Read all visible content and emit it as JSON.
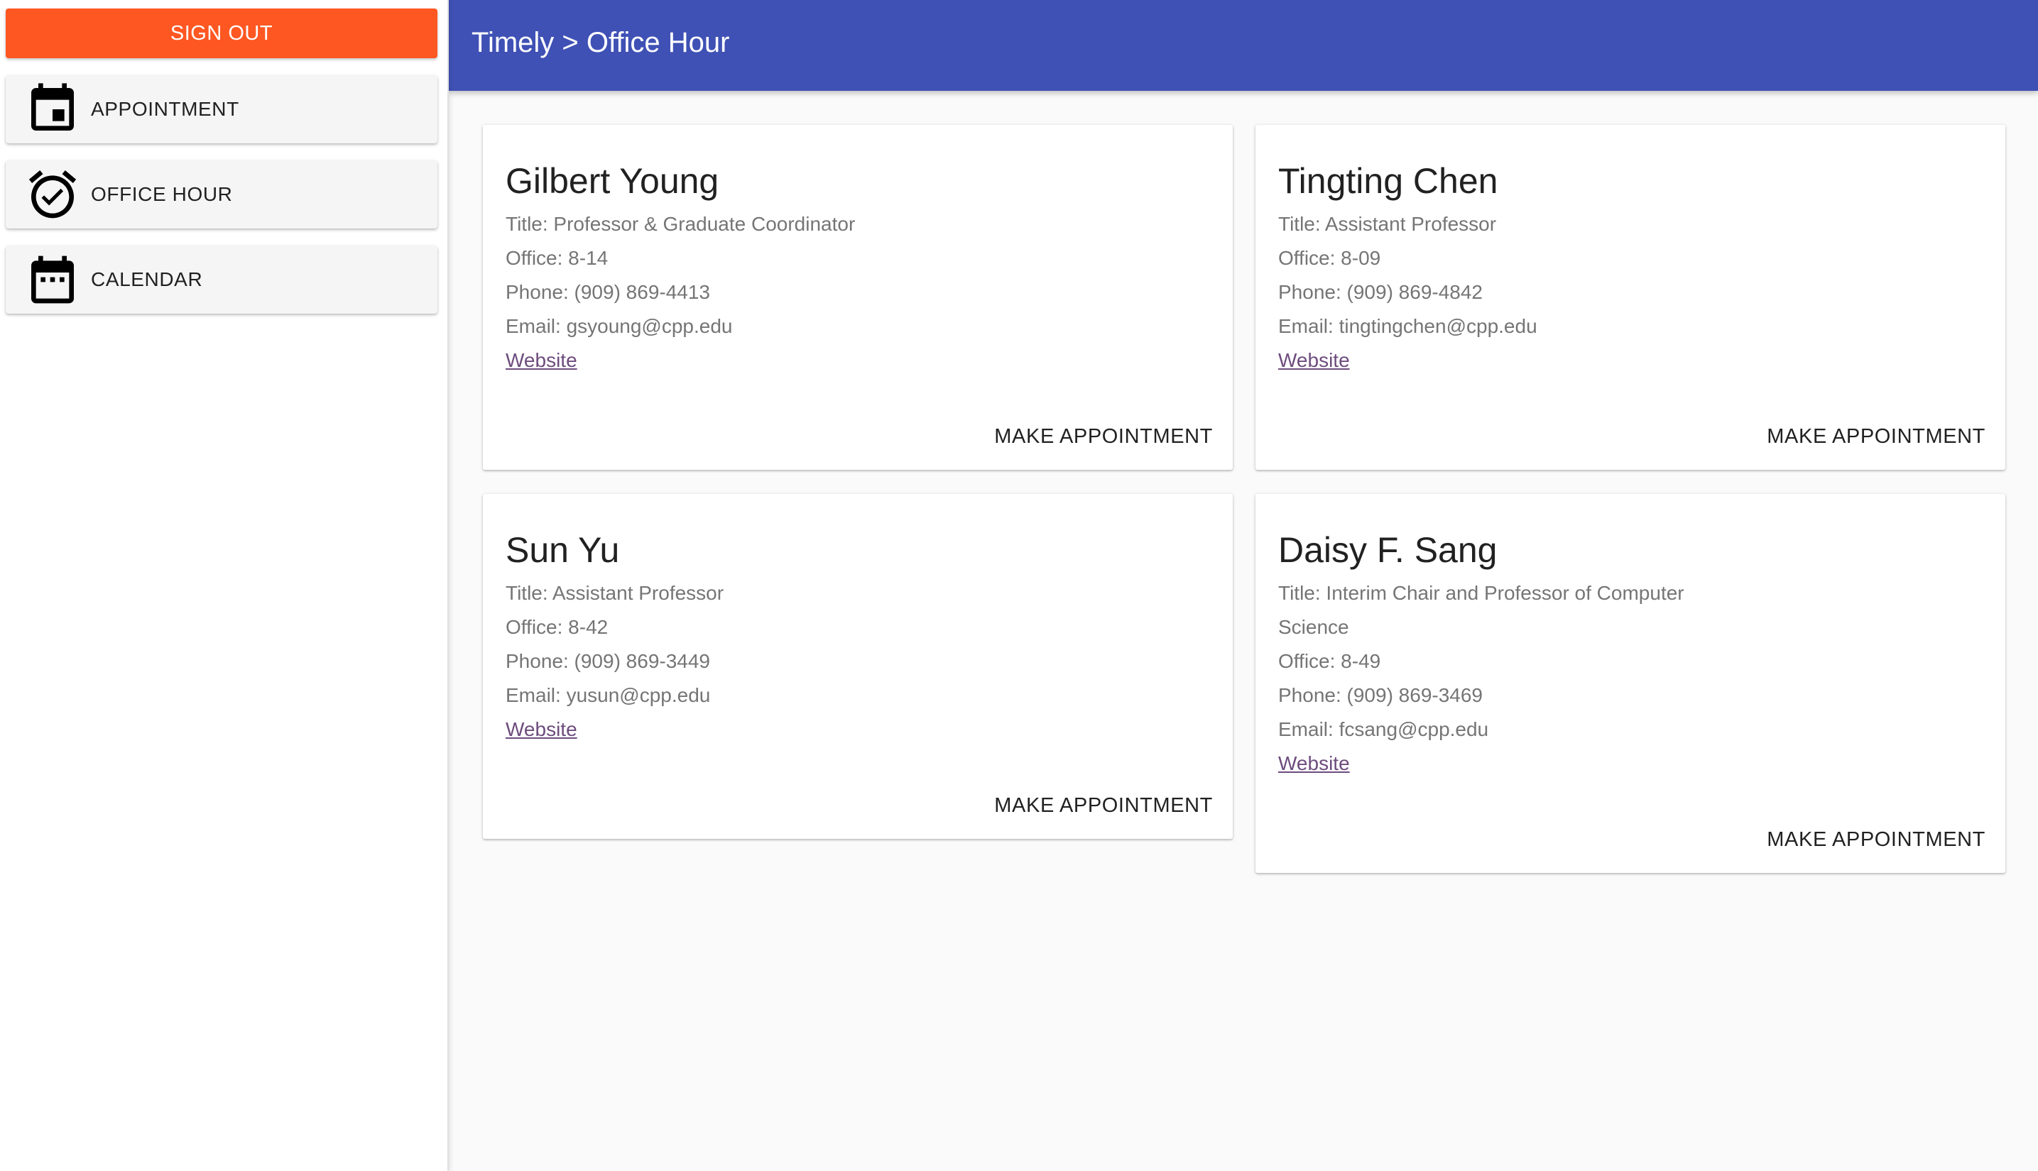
{
  "sidebar": {
    "signout_label": "SIGN OUT",
    "items": [
      {
        "label": "APPOINTMENT",
        "icon": "event-icon"
      },
      {
        "label": "OFFICE HOUR",
        "icon": "alarm-on-icon"
      },
      {
        "label": "CALENDAR",
        "icon": "date-range-icon"
      }
    ]
  },
  "header": {
    "breadcrumb": "Timely > Office Hour"
  },
  "colors": {
    "signout": "#ff5722",
    "header": "#3f51b5",
    "link": "#6d4c7d"
  },
  "cards": [
    {
      "name": "Gilbert Young",
      "title": "Title: Professor & Graduate Coordinator",
      "office": "Office: 8-14",
      "phone": "Phone: (909) 869-4413",
      "email": "Email: gsyoung@cpp.edu",
      "website": "Website",
      "action": "MAKE APPOINTMENT"
    },
    {
      "name": "Tingting Chen",
      "title": "Title: Assistant Professor",
      "office": "Office: 8-09",
      "phone": "Phone: (909) 869-4842",
      "email": "Email: tingtingchen@cpp.edu",
      "website": "Website",
      "action": "MAKE APPOINTMENT"
    },
    {
      "name": "Sun Yu",
      "title": "Title: Assistant Professor",
      "office": "Office: 8-42",
      "phone": "Phone: (909) 869-3449",
      "email": "Email: yusun@cpp.edu",
      "website": "Website",
      "action": "MAKE APPOINTMENT"
    },
    {
      "name": "Daisy F. Sang",
      "title": "Title: Interim Chair and Professor of Computer Science",
      "office": "Office: 8-49",
      "phone": "Phone: (909) 869-3469",
      "email": "Email: fcsang@cpp.edu",
      "website": "Website",
      "action": "MAKE APPOINTMENT"
    }
  ]
}
